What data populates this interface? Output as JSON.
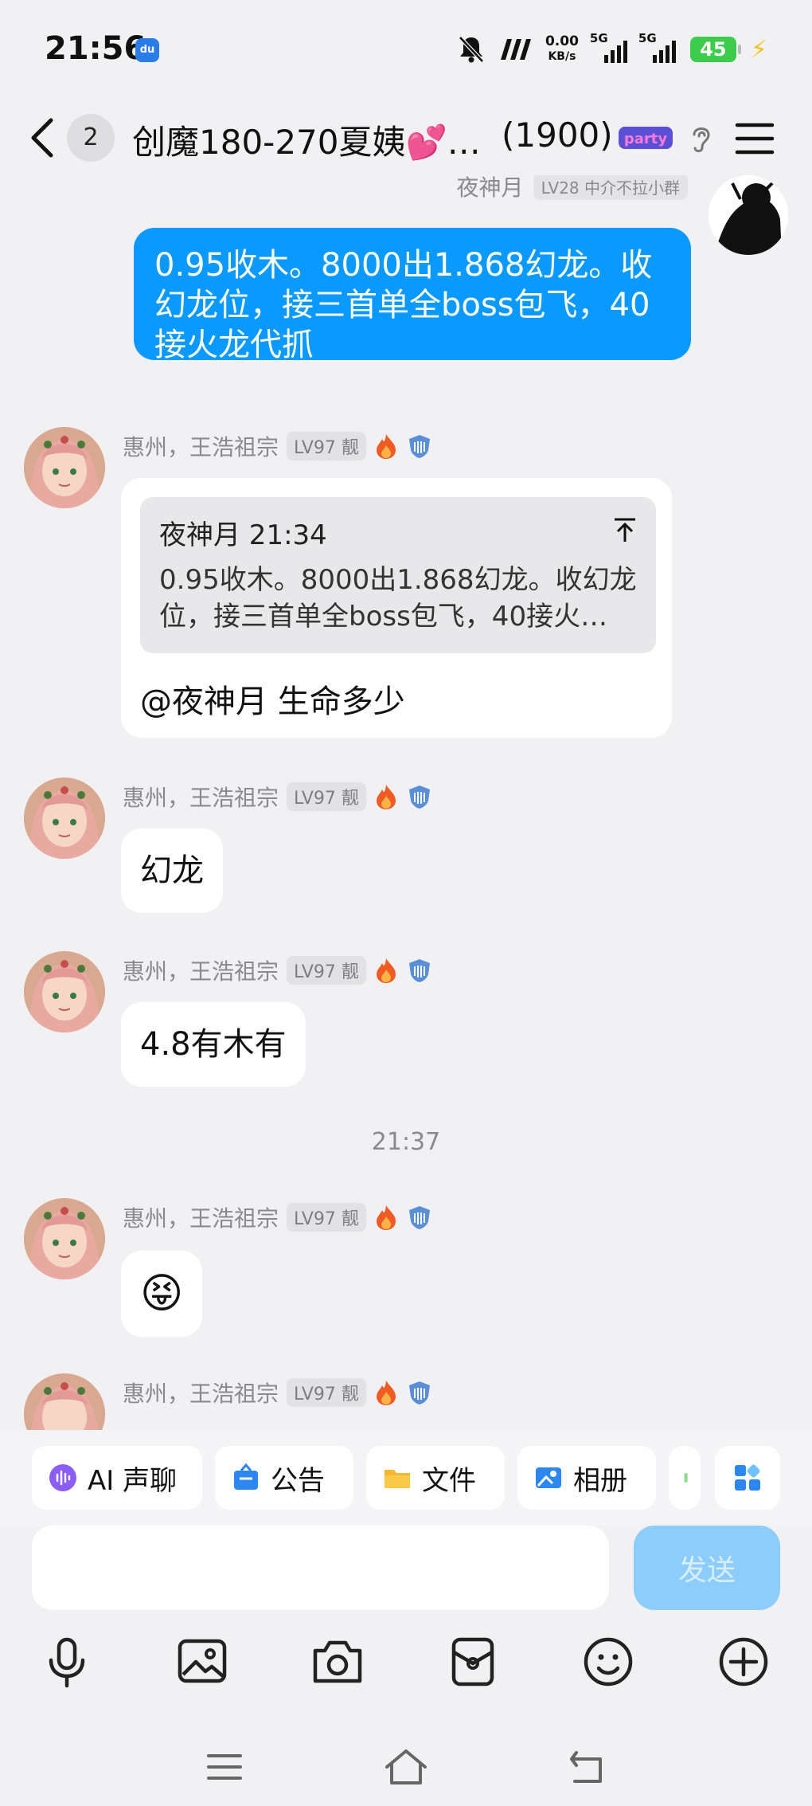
{
  "status_bar": {
    "time": "21:56",
    "app_icon_label": "du",
    "net_speed_value": "0.00",
    "net_speed_unit": "KB/s",
    "signal1_label": "5G",
    "signal2_label": "5G",
    "battery": "45"
  },
  "header": {
    "unread_count": "2",
    "title": "创魔180-270夏姨💕…",
    "member_count": "(1900)",
    "party_logo_text": "party"
  },
  "chat": {
    "self_message": {
      "sender": "夜神月",
      "tag": "LV28 中介不拉小群",
      "text": "0.95收木。8000出1.868幻龙。收幻龙位，接三首单全boss包飞，40接火龙代抓"
    },
    "sender_name": "惠州，王浩祖宗",
    "sender_level": "LV97 靓",
    "reply_message": {
      "quote_header": "夜神月 21:34",
      "quote_text": "0.95收木。8000出1.868幻龙。收幻龙位，接三首单全boss包飞，40接火…",
      "text": "@夜神月 生命多少"
    },
    "msg2": "幻龙",
    "msg3": "4.8有木有",
    "time_separator": "21:37",
    "msg4_emoji": "😝"
  },
  "quick_actions": [
    {
      "label": "AI 声聊"
    },
    {
      "label": "公告"
    },
    {
      "label": "文件"
    },
    {
      "label": "相册"
    }
  ],
  "input": {
    "value": "",
    "send_label": "发送"
  },
  "colors": {
    "self_bubble": "#0a99ff",
    "send_disabled": "#8dcdfb",
    "background": "#f1f1f3"
  }
}
